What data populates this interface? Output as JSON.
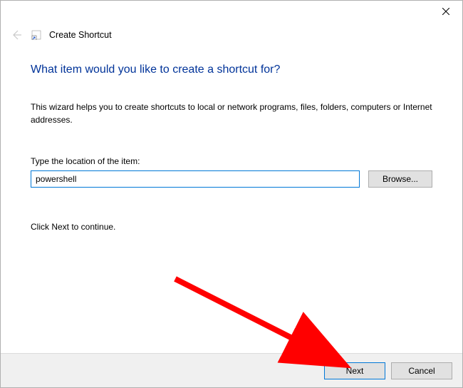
{
  "dialog": {
    "title": "Create Shortcut",
    "heading": "What item would you like to create a shortcut for?",
    "description": "This wizard helps you to create shortcuts to local or network programs, files, folders, computers or Internet addresses.",
    "location_label": "Type the location of the item:",
    "location_value": "powershell",
    "browse_label": "Browse...",
    "continue_text": "Click Next to continue."
  },
  "footer": {
    "next_label": "Next",
    "cancel_label": "Cancel"
  }
}
